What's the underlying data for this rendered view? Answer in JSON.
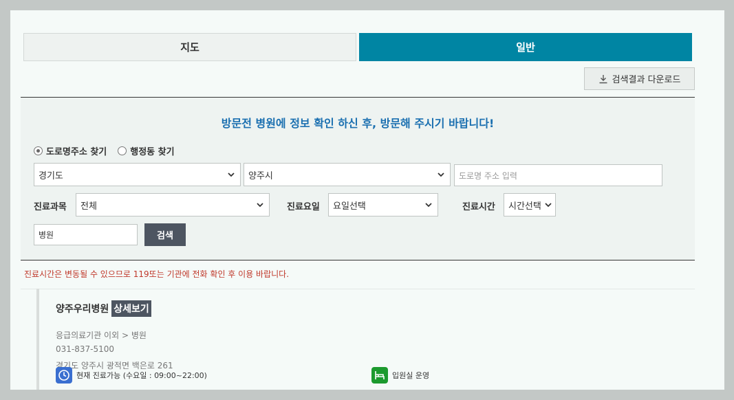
{
  "tabs": {
    "map": "지도",
    "general": "일반"
  },
  "download": {
    "label": "검색결과 다운로드"
  },
  "search": {
    "headline": "방문전 병원에 정보 확인 하신 후, 방문해 주시기 바랍니다!",
    "radio_road": "도로명주소 찾기",
    "radio_admin": "행정동 찾기",
    "province": "경기도",
    "city": "양주시",
    "road_placeholder": "도로명 주소 입력",
    "dept_label": "진료과목",
    "dept_value": "전체",
    "day_label": "진료요일",
    "day_value": "요일선택",
    "time_label": "진료시간",
    "time_value": "시간선택",
    "keyword_value": "병원",
    "search_btn": "검색"
  },
  "notice": "진료시간은 변동될 수 있으므로 119또는 기관에 전화 확인 후 이용 바랍니다.",
  "result": {
    "name": "양주우리병원",
    "detail_link": "상세보기",
    "category": "응급의료기관 이외 > 병원",
    "phone": "031-837-5100",
    "address": "경기도 양주시 광적면 백은로 261",
    "hours": "현재 진료가능 (수요일 : 09:00~22:00)",
    "ward": "입원실 운영"
  },
  "colors": {
    "accent": "#0085a3",
    "headline": "#1a6fb0",
    "notice": "#c0392b",
    "button": "#4d5561"
  }
}
